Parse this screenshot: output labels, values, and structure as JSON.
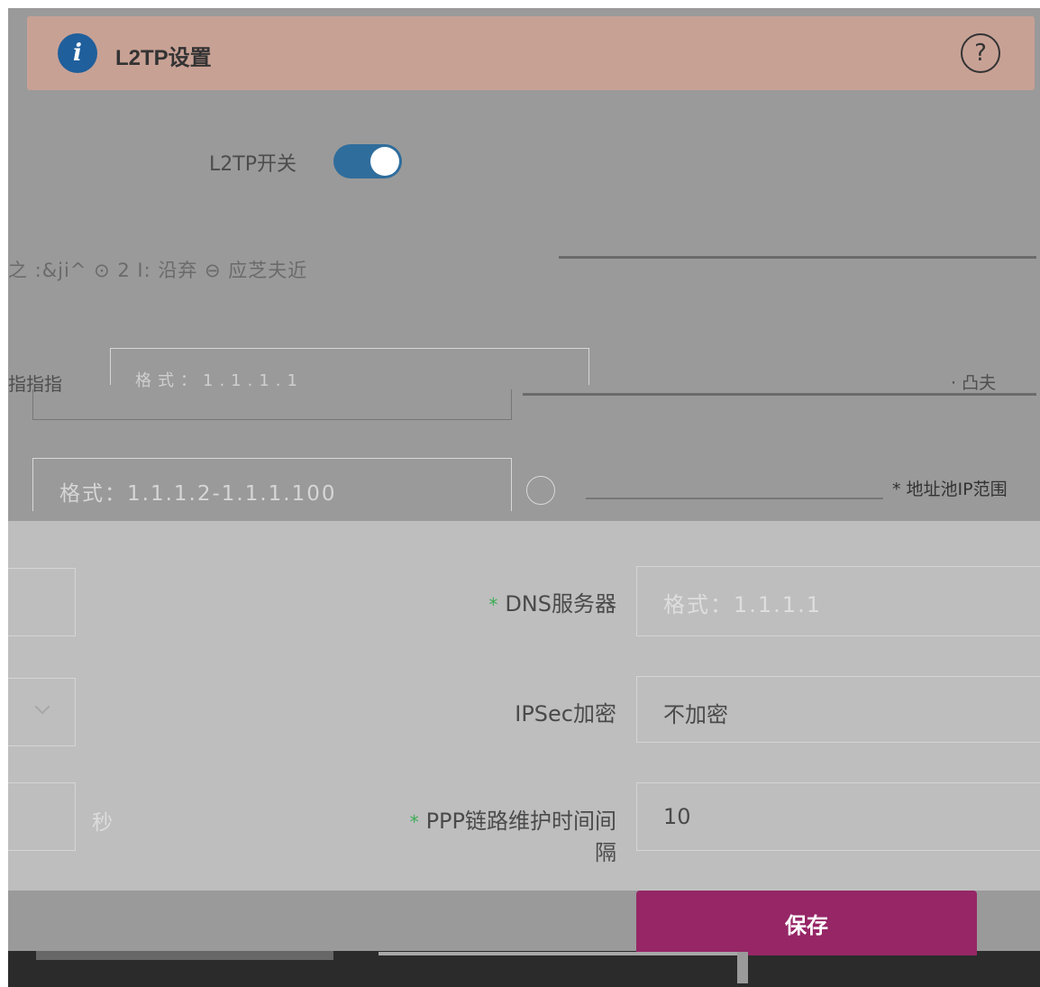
{
  "header": {
    "title": "L2TP设置",
    "info_icon": "info-icon",
    "help_icon": "question-circle-icon",
    "help_symbol": "?"
  },
  "l2tp_switch": {
    "label": "L2TP开关",
    "enabled": true
  },
  "garbled_row": {
    "text": "之 :&ji^ ⊙ 2 I: 沿弃 ⊖ 应芝夫近"
  },
  "address_field": {
    "label": "指指指",
    "placeholder": "格式：1.1.1.1",
    "right_text": "· 凸夫"
  },
  "range_field": {
    "placeholder": "格式：1.1.1.2-1.1.1.100",
    "right_label": "* 地址池IP范围"
  },
  "dns": {
    "label": "DNS服务器",
    "required": true,
    "placeholder": "格式：1.1.1.1"
  },
  "ipsec": {
    "label": "IPSec加密",
    "value": "不加密"
  },
  "ppp": {
    "label": "PPP链路维护时间间隔",
    "required": true,
    "value": "10",
    "unit": "秒"
  },
  "actions": {
    "save_label": "保存"
  },
  "colors": {
    "header_bg": "#c8a195",
    "switch_on": "#2f6d9c",
    "save_bg": "#962666",
    "required": "#3cad55"
  }
}
